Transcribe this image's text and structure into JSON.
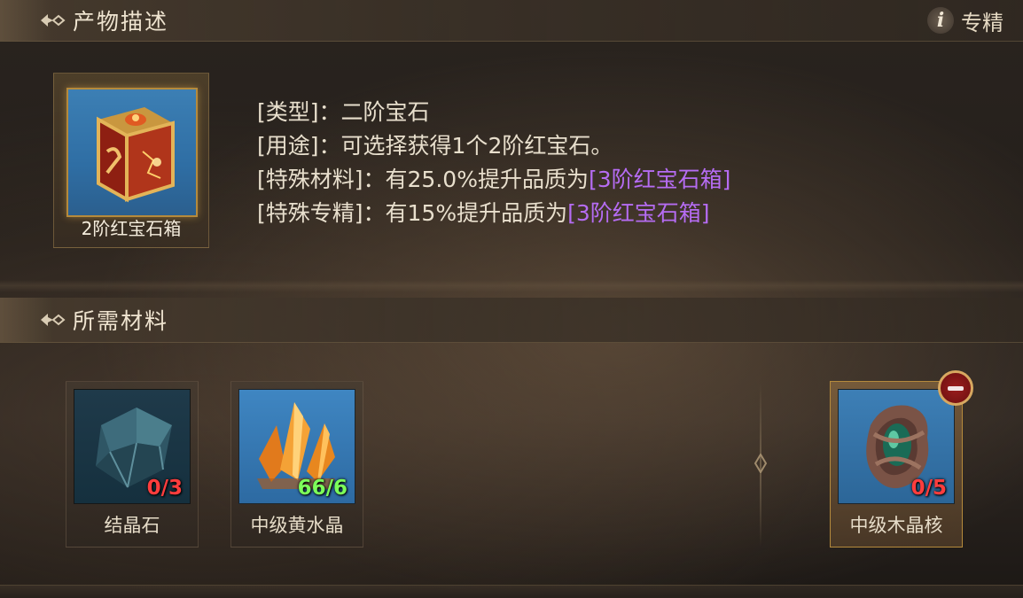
{
  "sections": {
    "product": {
      "title": "产物描述"
    },
    "materials": {
      "title": "所需材料"
    }
  },
  "info_button": {
    "label": "专精",
    "icon": "i"
  },
  "product": {
    "name": "2阶红宝石箱",
    "icon": "red-gem-box-icon"
  },
  "description": {
    "type_label": "[类型]",
    "type_value": "二阶宝石",
    "use_label": "[用途]",
    "use_value": "可选择获得1个2阶红宝石。",
    "special_material_label": "[特殊材料]",
    "special_material_text": "有25.0%提升品质为",
    "special_material_target": "[3阶红宝石箱]",
    "special_mastery_label": "[特殊专精]",
    "special_mastery_text": "有15%提升品质为",
    "special_mastery_target": "[3阶红宝石箱]",
    "separator": "："
  },
  "materials": [
    {
      "name": "结晶石",
      "count": "0/3",
      "status": "insufficient",
      "icon": "crystal-stone-icon"
    },
    {
      "name": "中级黄水晶",
      "count": "66/6",
      "status": "sufficient",
      "icon": "citrine-crystal-icon"
    },
    {
      "name": "中级木晶核",
      "count": "0/5",
      "status": "insufficient",
      "icon": "wood-crystal-core-icon",
      "removable": true
    }
  ],
  "colors": {
    "highlight_purple": "#b56cf2",
    "insufficient_red": "#ff3d3d",
    "sufficient_green": "#7cff5a"
  }
}
